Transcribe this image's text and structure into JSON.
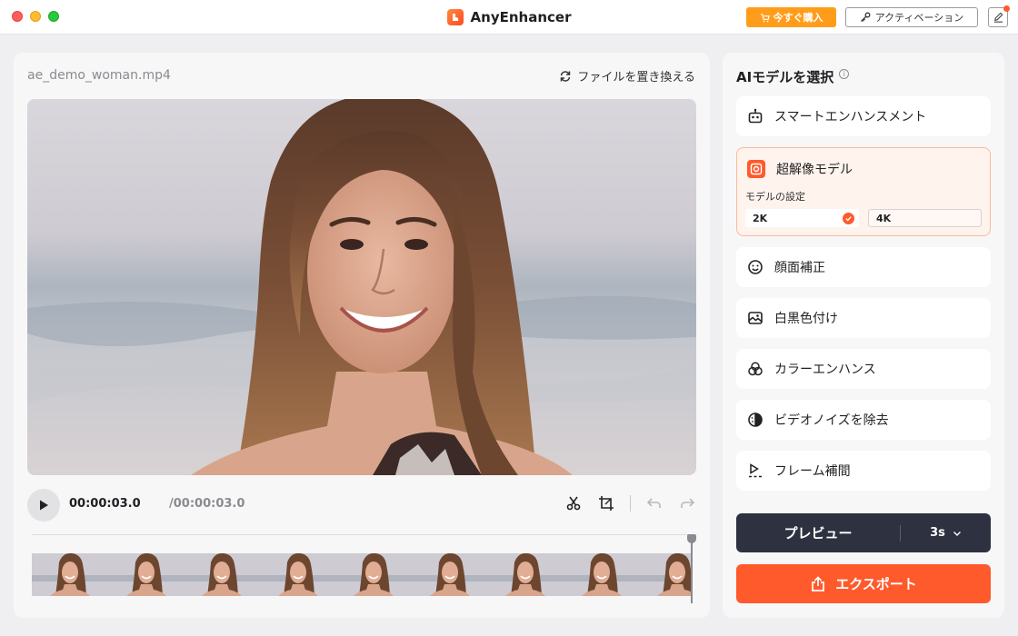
{
  "window": {
    "title": "AnyEnhancer",
    "buy_label": "今すぐ購入",
    "activate_label": "アクティベーション"
  },
  "editor": {
    "file_name": "ae_demo_woman.mp4",
    "replace_label": "ファイルを置き換える",
    "time_current": "00:00:03.0",
    "time_total": "/00:00:03.0",
    "playhead_progress": 1.0
  },
  "models": {
    "title": "AIモデルを選択",
    "info_glyph": "i",
    "items": [
      {
        "label": "スマートエンハンスメント",
        "icon": "robot-icon"
      },
      {
        "label": "超解像モデル",
        "icon": "super-resolution-icon",
        "active": true
      },
      {
        "label": "顔面補正",
        "icon": "face-icon"
      },
      {
        "label": "白黒色付け",
        "icon": "colorize-icon"
      },
      {
        "label": "カラーエンハンス",
        "icon": "color-enhance-icon"
      },
      {
        "label": "ビデオノイズを除去",
        "icon": "denoise-icon"
      },
      {
        "label": "フレーム補間",
        "icon": "frame-interpolation-icon"
      }
    ],
    "setting_label": "モデルの設定",
    "resolutions": [
      {
        "label": "2K",
        "selected": true
      },
      {
        "label": "4K",
        "selected": false
      }
    ]
  },
  "actions": {
    "preview_label": "プレビュー",
    "preview_duration": "3s",
    "export_label": "エクスポート"
  },
  "colors": {
    "accent": "#ff5a2c",
    "buy": "#ff9d1a",
    "dark_button": "#2d3140"
  }
}
